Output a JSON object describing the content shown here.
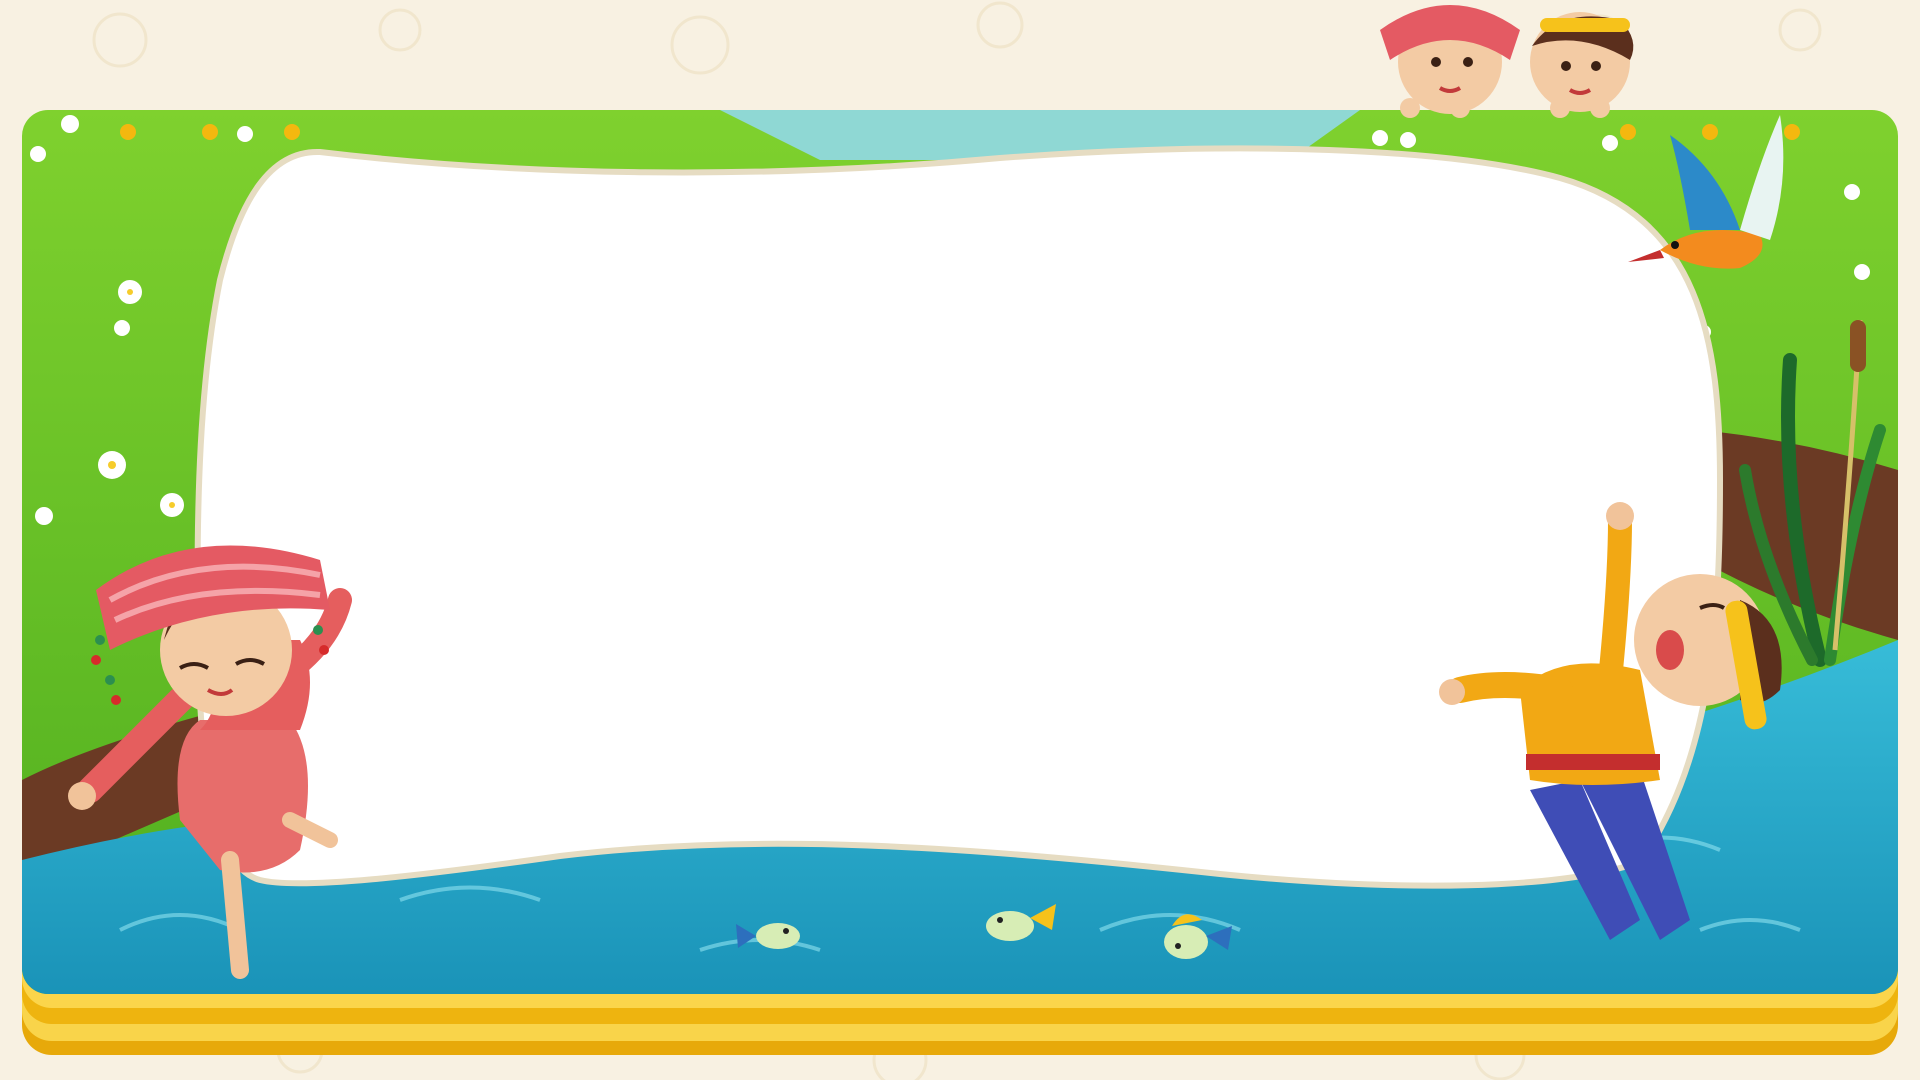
{
  "slide": {
    "title": "",
    "body": ""
  },
  "colors": {
    "page_background": "#f8f1e2",
    "frame_gold": "#f5c21b",
    "frame_gold_dark": "#e0a400",
    "grass_light": "#8bd534",
    "grass_dark": "#4ea91e",
    "river": "#2fb0cf",
    "river_dark": "#1c8fb4",
    "bank_brown": "#6b3a24",
    "canvas_white": "#ffffff",
    "canvas_border": "#d8ccb0"
  },
  "illustration": {
    "girl": "dancing-girl-red-headdress",
    "boy": "dancing-boy-yellow-headband",
    "peeking_kids": "two-peeking-children",
    "bird": "kingfisher-bird",
    "plant": "cattail-reeds",
    "fish_count": 3
  }
}
